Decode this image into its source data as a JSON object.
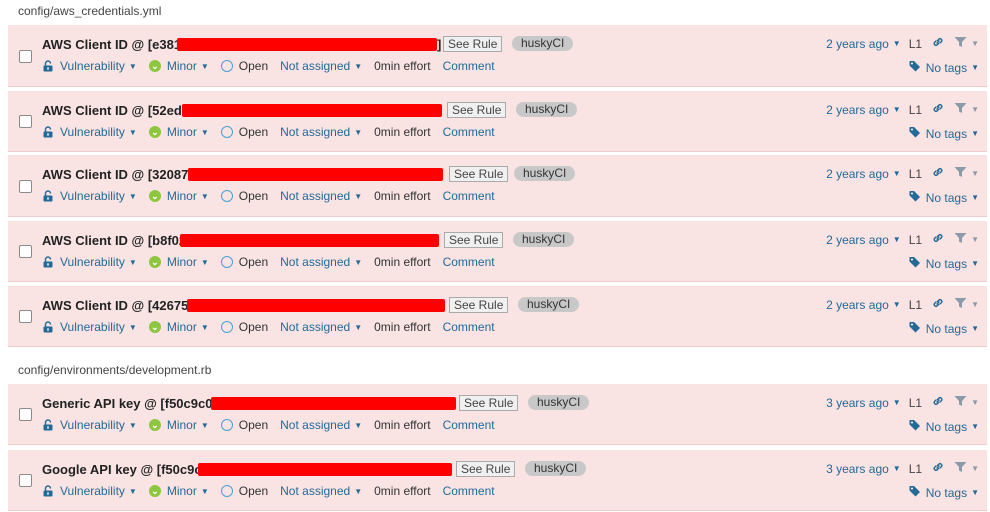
{
  "groups": [
    {
      "file": "config/aws_credentials.yml",
      "issues": [
        {
          "title": "AWS Client ID @ [e381",
          "title_end": "]",
          "see_rule": "See Rule",
          "tag": "huskyCI",
          "age": "2 years ago",
          "line": "L1"
        },
        {
          "title": "AWS Client ID @ [52ed",
          "title_end": "",
          "see_rule": "See Rule",
          "tag": "huskyCI",
          "age": "2 years ago",
          "line": "L1"
        },
        {
          "title": "AWS Client ID @ [32087",
          "title_end": "",
          "see_rule": "See Rule",
          "tag": "huskyCI",
          "age": "2 years ago",
          "line": "L1"
        },
        {
          "title": "AWS Client ID @ [b8f02",
          "title_end": "",
          "see_rule": "See Rule",
          "tag": "huskyCI",
          "age": "2 years ago",
          "line": "L1"
        },
        {
          "title": "AWS Client ID @ [42675",
          "title_end": "",
          "see_rule": "See Rule",
          "tag": "huskyCI",
          "age": "2 years ago",
          "line": "L1"
        }
      ]
    },
    {
      "file": "config/environments/development.rb",
      "issues": [
        {
          "title": "Generic API key @ [f50c9c0",
          "title_end": "",
          "see_rule": "See Rule",
          "tag": "huskyCI",
          "age": "3 years ago",
          "line": "L1"
        },
        {
          "title": "Google API key @ [f50c9c",
          "title_end": "",
          "see_rule": "See Rule",
          "tag": "huskyCI",
          "age": "3 years ago",
          "line": "L1"
        }
      ]
    }
  ],
  "meta": {
    "type": "Vulnerability",
    "severity": "Minor",
    "status": "Open",
    "assignee": "Not assigned",
    "effort": "0min effort",
    "comment": "Comment",
    "tags": "No tags"
  },
  "colors": {
    "row_bg": "#f9e3e3",
    "link": "#236a97",
    "redaction": "#ff0000",
    "minor": "#8dc63f"
  }
}
